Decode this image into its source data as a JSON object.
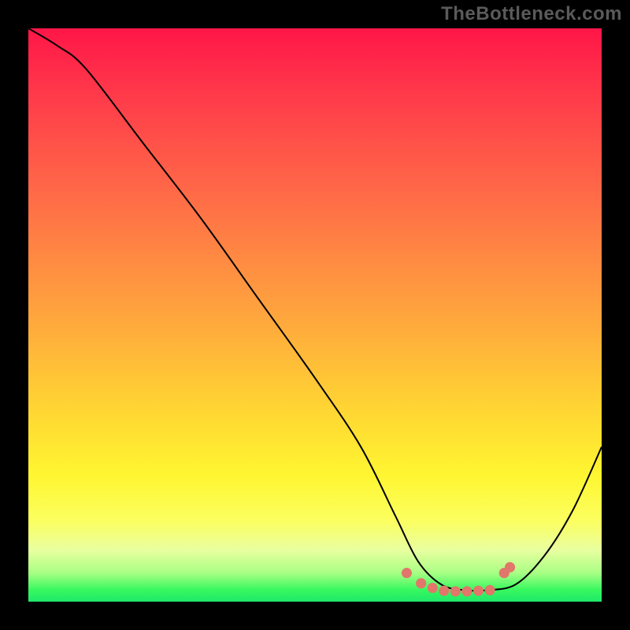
{
  "watermark": "TheBottleneck.com",
  "chart_data": {
    "type": "line",
    "title": "",
    "xlabel": "",
    "ylabel": "",
    "xlim": [
      0,
      100
    ],
    "ylim": [
      0,
      100
    ],
    "grid": false,
    "series": [
      {
        "name": "curve",
        "x": [
          0,
          5,
          10,
          20,
          30,
          40,
          50,
          58,
          64,
          68,
          72,
          76,
          80,
          85,
          90,
          95,
          100
        ],
        "values": [
          100,
          97,
          93,
          80,
          67,
          53,
          39,
          27,
          15,
          7,
          3,
          2,
          2,
          3,
          8,
          16,
          27
        ],
        "color": "#000000"
      }
    ],
    "markers": {
      "name": "dots",
      "color": "#e2766a",
      "points": [
        {
          "x": 66,
          "y": 5
        },
        {
          "x": 68.5,
          "y": 3.2
        },
        {
          "x": 70.5,
          "y": 2.4
        },
        {
          "x": 72.5,
          "y": 1.9
        },
        {
          "x": 74.5,
          "y": 1.8
        },
        {
          "x": 76.5,
          "y": 1.8
        },
        {
          "x": 78.5,
          "y": 1.9
        },
        {
          "x": 80.5,
          "y": 2.0
        },
        {
          "x": 83,
          "y": 5
        },
        {
          "x": 84,
          "y": 6
        }
      ]
    },
    "gradient_stops": [
      {
        "offset": 0,
        "color": "#ff1648"
      },
      {
        "offset": 12,
        "color": "#ff3b4a"
      },
      {
        "offset": 30,
        "color": "#ff6d47"
      },
      {
        "offset": 49,
        "color": "#ffa23e"
      },
      {
        "offset": 66,
        "color": "#ffd433"
      },
      {
        "offset": 78,
        "color": "#fff631"
      },
      {
        "offset": 86,
        "color": "#fbff60"
      },
      {
        "offset": 91,
        "color": "#e9ffa0"
      },
      {
        "offset": 95,
        "color": "#a8ff84"
      },
      {
        "offset": 98,
        "color": "#36f85f"
      },
      {
        "offset": 100,
        "color": "#20e86a"
      }
    ]
  }
}
